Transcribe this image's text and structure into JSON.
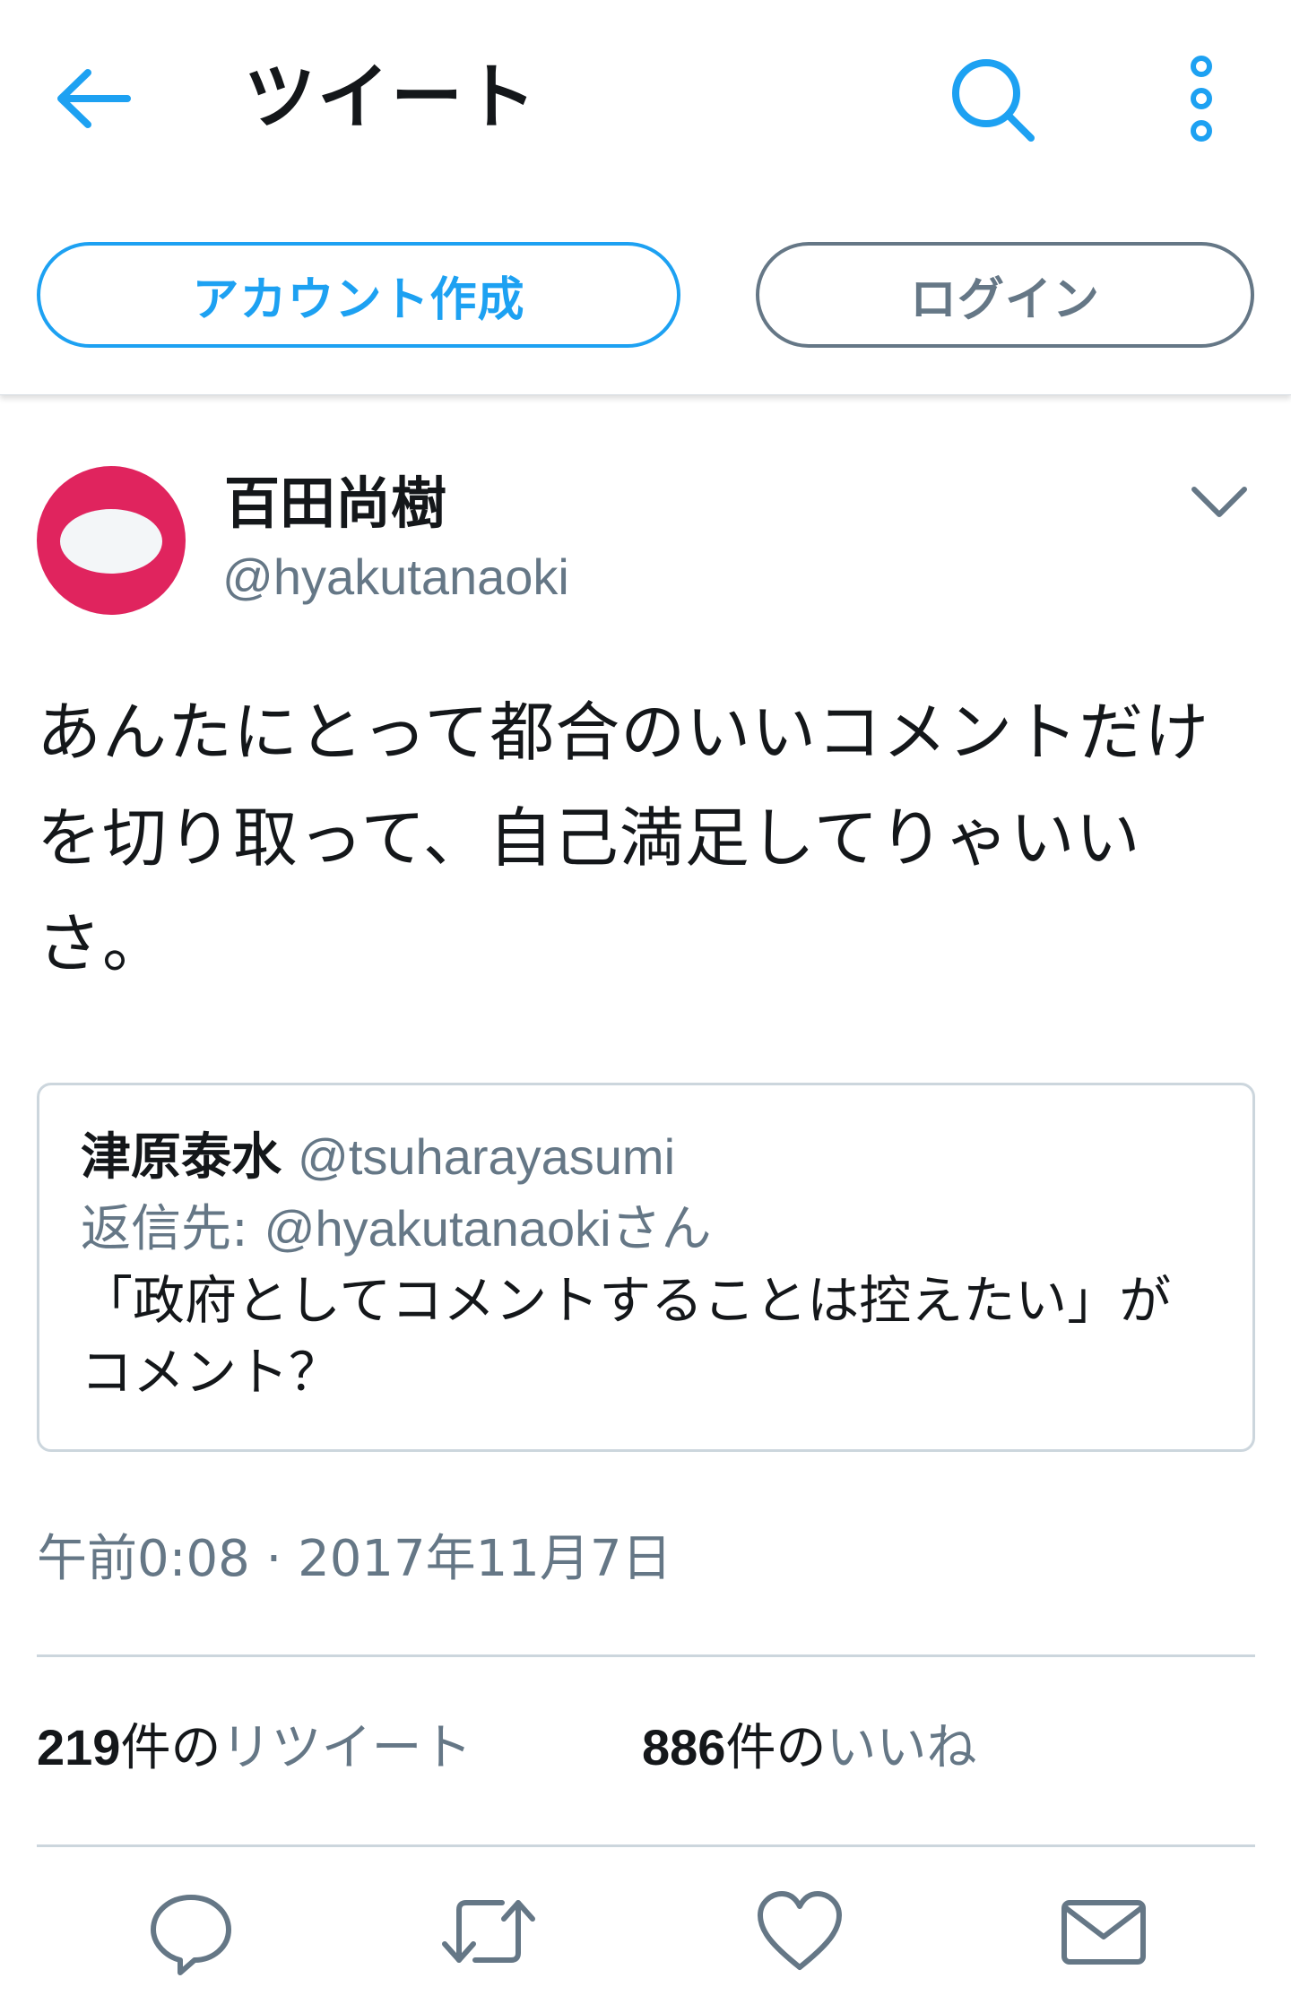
{
  "header": {
    "title": "ツイート",
    "icons": {
      "back": "arrow-left-icon",
      "search": "search-icon",
      "more": "vertical-dots-icon"
    },
    "signup_label": "アカウント作成",
    "login_label": "ログイン"
  },
  "colors": {
    "accent": "#1da1f2",
    "secondary_text": "#657786",
    "border": "#ccd6dd",
    "avatar": "#e0245e"
  },
  "tweet": {
    "author_name": "百田尚樹",
    "author_handle": "@hyakutanaoki",
    "text": "あんたにとって都合のいいコメントだけを切り取って、自己満足してりゃいいさ。",
    "timestamp": "午前0:08 · 2017年11月7日",
    "quote": {
      "name": "津原泰水",
      "handle": "@tsuharayasumi",
      "reply_prefix": "返信先: ",
      "reply_handle": "@hyakutanaoki",
      "reply_suffix": "さん",
      "text": "「政府としてコメントすることは控えたい」がコメント？"
    },
    "stats": {
      "retweets_count": "219",
      "retweets_unit": "件の",
      "retweets_label": "リツイート",
      "likes_count": "886",
      "likes_unit": "件の",
      "likes_label": "いいね"
    }
  },
  "actions": {
    "reply": "reply-icon",
    "retweet": "retweet-icon",
    "like": "heart-icon",
    "message": "envelope-icon"
  }
}
